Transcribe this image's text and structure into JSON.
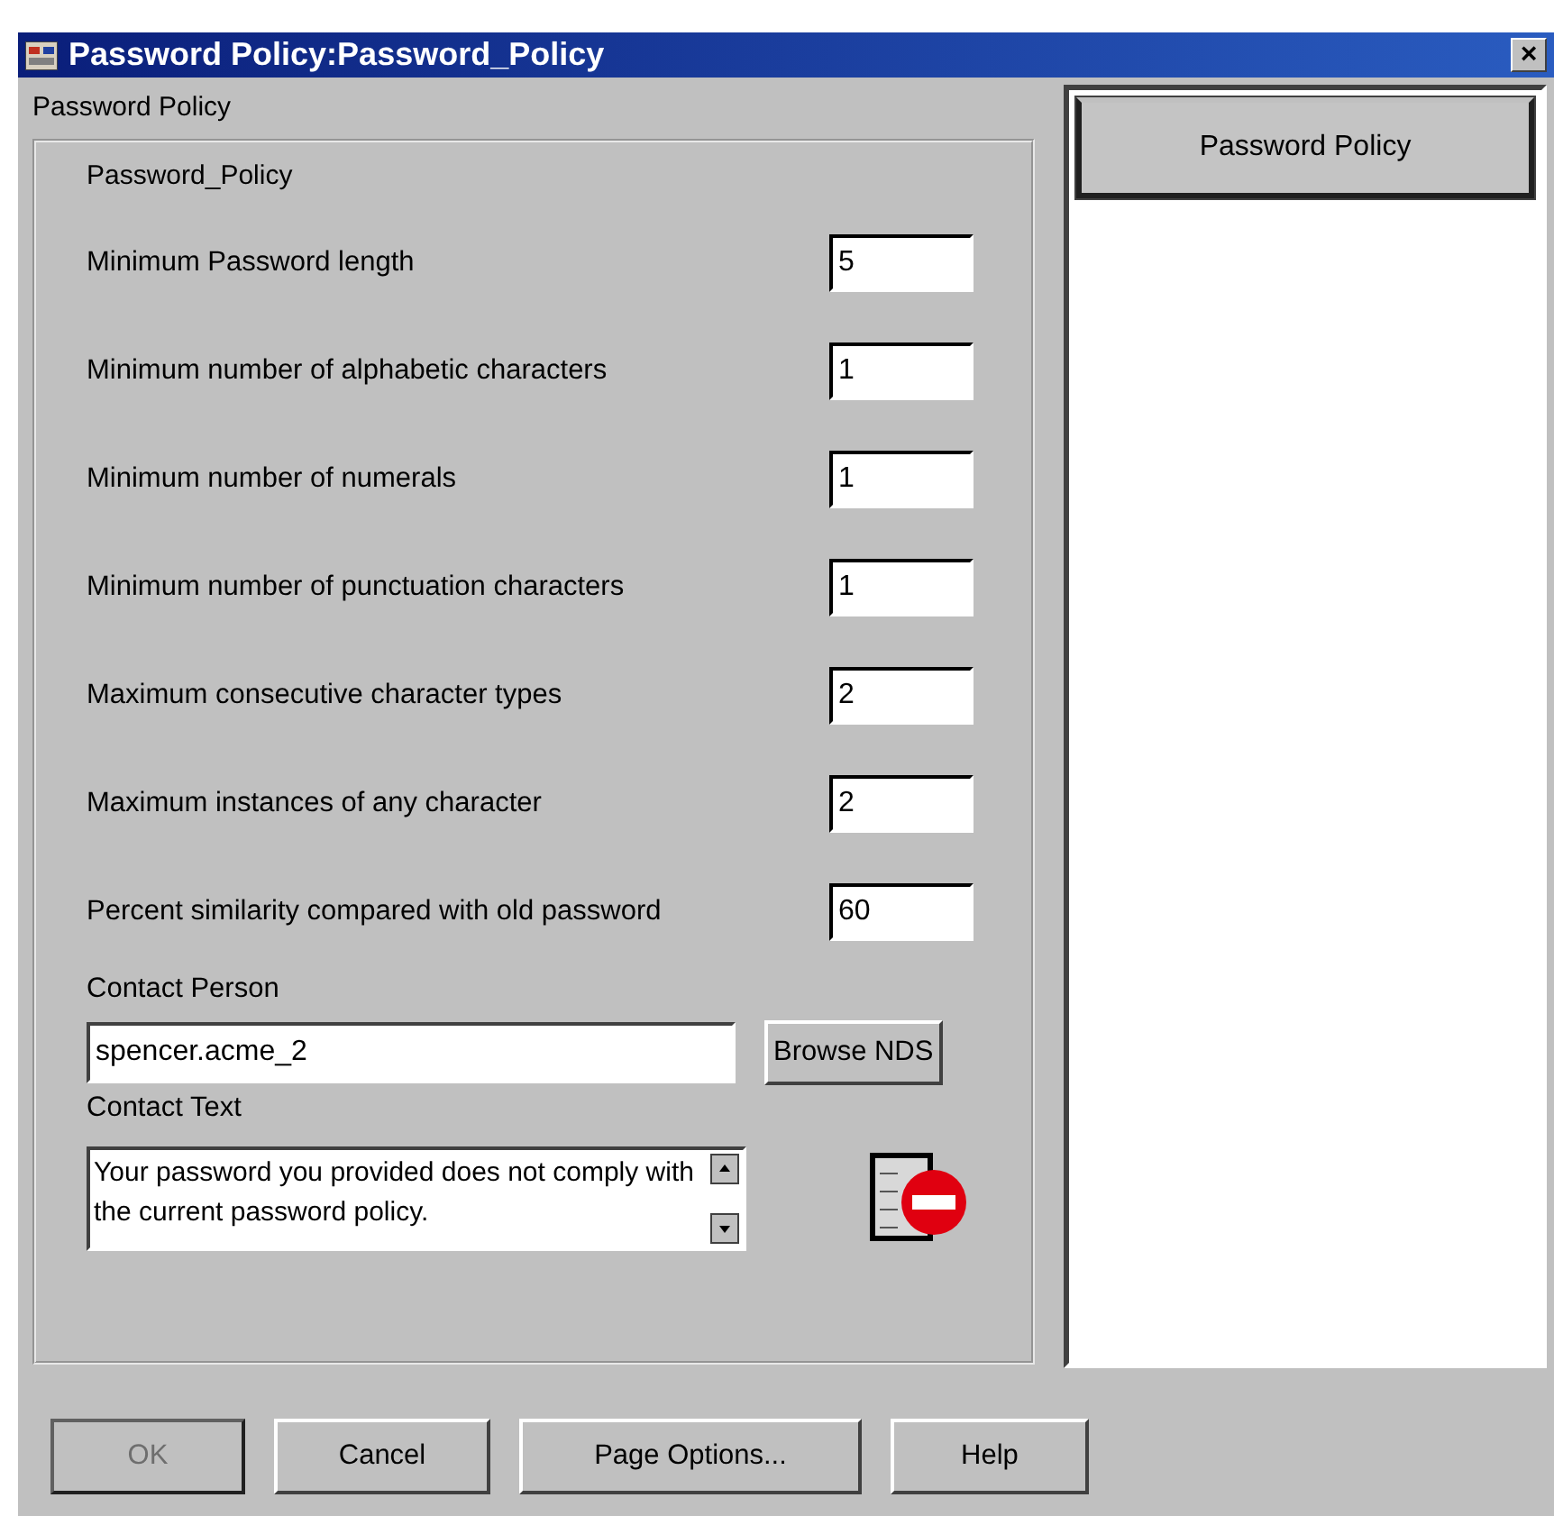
{
  "window": {
    "title": "Password  Policy:Password_Policy",
    "close": "×"
  },
  "group": {
    "title": "Password Policy",
    "subtitle": "Password_Policy"
  },
  "fields": [
    {
      "label": "Minimum Password length",
      "value": "5"
    },
    {
      "label": "Minimum number of alphabetic characters",
      "value": "1"
    },
    {
      "label": "Minimum number of numerals",
      "value": "1"
    },
    {
      "label": "Minimum number of punctuation characters",
      "value": "1"
    },
    {
      "label": "Maximum consecutive character types",
      "value": "2"
    },
    {
      "label": "Maximum instances of any character",
      "value": "2"
    },
    {
      "label": "Percent similarity compared with old password",
      "value": "60"
    }
  ],
  "contact_person": {
    "label": "Contact Person",
    "value": "spencer.acme_2",
    "button": "Browse NDS"
  },
  "contact_text": {
    "label": "Contact Text",
    "value": "Your password you provided does not comply with the current password policy."
  },
  "pages": [
    {
      "label": "Password Policy",
      "selected": true
    }
  ],
  "buttons": [
    {
      "label": "OK",
      "disabled": true
    },
    {
      "label": "Cancel",
      "disabled": false
    },
    {
      "label": "Page Options...",
      "disabled": false
    },
    {
      "label": "Help",
      "disabled": false
    }
  ]
}
